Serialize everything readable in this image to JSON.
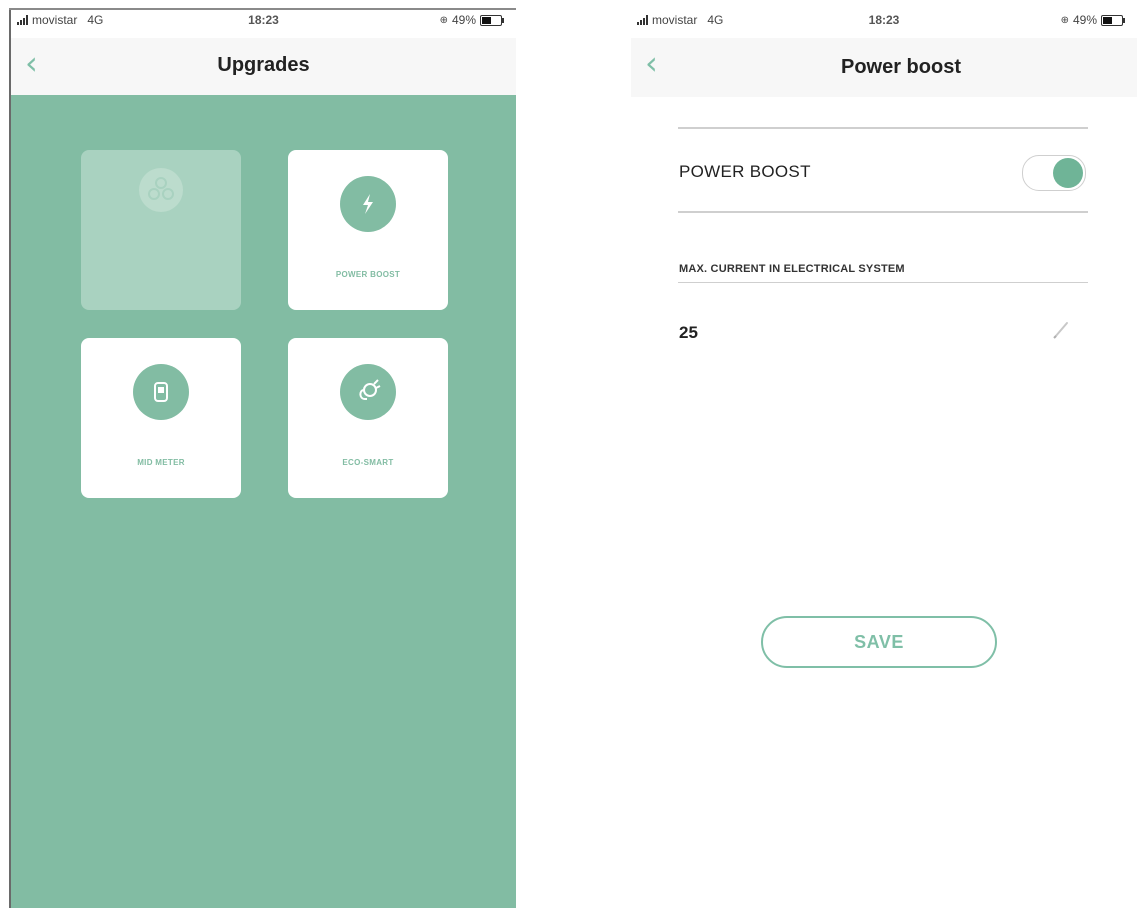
{
  "status_left": {
    "carrier": "movistar",
    "network": "4G",
    "time": "18:23",
    "battery": "49%"
  },
  "status_right": {
    "carrier": "movistar",
    "network": "4G",
    "time": "18:23",
    "battery": "49%"
  },
  "upgrades_screen": {
    "title": "Upgrades",
    "tiles": [
      {
        "label": "",
        "icon": "scheduler-icon",
        "enabled": false
      },
      {
        "label": "POWER BOOST",
        "icon": "lightning-icon",
        "enabled": true
      },
      {
        "label": "MID METER",
        "icon": "meter-icon",
        "enabled": true
      },
      {
        "label": "ECO-SMART",
        "icon": "eco-plug-icon",
        "enabled": true
      }
    ]
  },
  "power_boost_screen": {
    "title": "Power boost",
    "toggle_label": "POWER BOOST",
    "toggle_on": true,
    "section_label": "MAX. CURRENT IN ELECTRICAL SYSTEM",
    "current_value": "25",
    "save_label": "SAVE"
  },
  "colors": {
    "accent": "#82bca3",
    "toggle_on": "#6fb497",
    "navbar": "#f7f7f7"
  }
}
